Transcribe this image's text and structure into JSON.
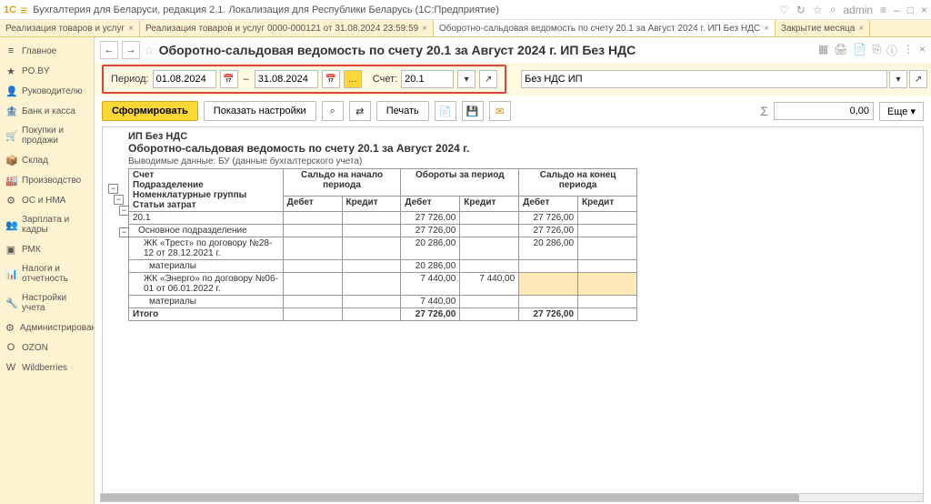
{
  "titlebar": {
    "logo": "1C",
    "title": "Бухгалтерия для Беларуси, редакция 2.1. Локализация для Республики Беларусь  (1С:Предприятие)",
    "user": "admin"
  },
  "tabs": [
    {
      "label": "Реализация товаров и услуг",
      "active": false
    },
    {
      "label": "Реализация товаров и услуг 0000-000121 от 31.08.2024 23:59:59",
      "active": false
    },
    {
      "label": "Оборотно-сальдовая ведомость по счету 20.1 за Август 2024 г. ИП Без НДС",
      "active": true
    },
    {
      "label": "Закрытие месяца",
      "active": false
    }
  ],
  "sidebar": {
    "items": [
      {
        "icon": "≡",
        "label": "Главное"
      },
      {
        "icon": "★",
        "label": "PO.BY"
      },
      {
        "icon": "👤",
        "label": "Руководителю"
      },
      {
        "icon": "🏦",
        "label": "Банк и касса"
      },
      {
        "icon": "🛒",
        "label": "Покупки и продажи"
      },
      {
        "icon": "📦",
        "label": "Склад"
      },
      {
        "icon": "🏭",
        "label": "Производство"
      },
      {
        "icon": "⚙",
        "label": "ОС и НМА"
      },
      {
        "icon": "👥",
        "label": "Зарплата и кадры"
      },
      {
        "icon": "▣",
        "label": "РМК"
      },
      {
        "icon": "📊",
        "label": "Налоги и отчетность"
      },
      {
        "icon": "🔧",
        "label": "Настройки учета"
      },
      {
        "icon": "⚙",
        "label": "Администрирование"
      },
      {
        "icon": "O",
        "label": "OZON"
      },
      {
        "icon": "W",
        "label": "Wildberries"
      }
    ]
  },
  "page": {
    "title": "Оборотно-сальдовая ведомость по счету 20.1 за Август 2024 г. ИП Без НДС"
  },
  "params": {
    "period_label": "Период:",
    "date_from": "01.08.2024",
    "date_to": "31.08.2024",
    "account_label": "Счет:",
    "account": "20.1",
    "org": "Без НДС ИП"
  },
  "toolbar": {
    "generate": "Сформировать",
    "show_settings": "Показать настройки",
    "print": "Печать",
    "sum": "0,00",
    "more": "Еще"
  },
  "report": {
    "org": "ИП Без НДС",
    "title": "Оборотно-сальдовая ведомость по счету 20.1 за Август 2024 г.",
    "subtitle": "Выводимые данные:   БУ (данные бухгалтерского учета)",
    "headers": {
      "account": "Счет",
      "opening": "Сальдо на начало периода",
      "turnover": "Обороты за период",
      "closing": "Сальдо на конец периода",
      "unit": "Подразделение",
      "groups": "Номенклатурные группы",
      "costs": "Статьи затрат",
      "debit": "Дебет",
      "credit": "Кредит"
    },
    "rows": [
      {
        "label": "20.1",
        "od": "27 726,00",
        "oc": "",
        "cd": "27 726,00"
      },
      {
        "label": "Основное подразделение",
        "od": "27 726,00",
        "oc": "",
        "cd": "27 726,00"
      },
      {
        "label": "ЖК «Трест» по договору №28-12 от 28.12.2021 г.",
        "od": "20 286,00",
        "oc": "",
        "cd": "20 286,00"
      },
      {
        "label": "материалы",
        "od": "20 286,00",
        "oc": "",
        "cd": "",
        "hl": true
      },
      {
        "label": "ЖК «Энерго» по договору №06-01 от 06.01.2022 г.",
        "od": "7 440,00",
        "oc": "7 440,00",
        "cd": "",
        "hlcell": true
      },
      {
        "label": "материалы",
        "od": "7 440,00",
        "oc": "",
        "cd": "",
        "hl": true
      }
    ],
    "total": {
      "label": "Итого",
      "od": "27 726,00",
      "oc": "",
      "cd": "27 726,00"
    }
  }
}
